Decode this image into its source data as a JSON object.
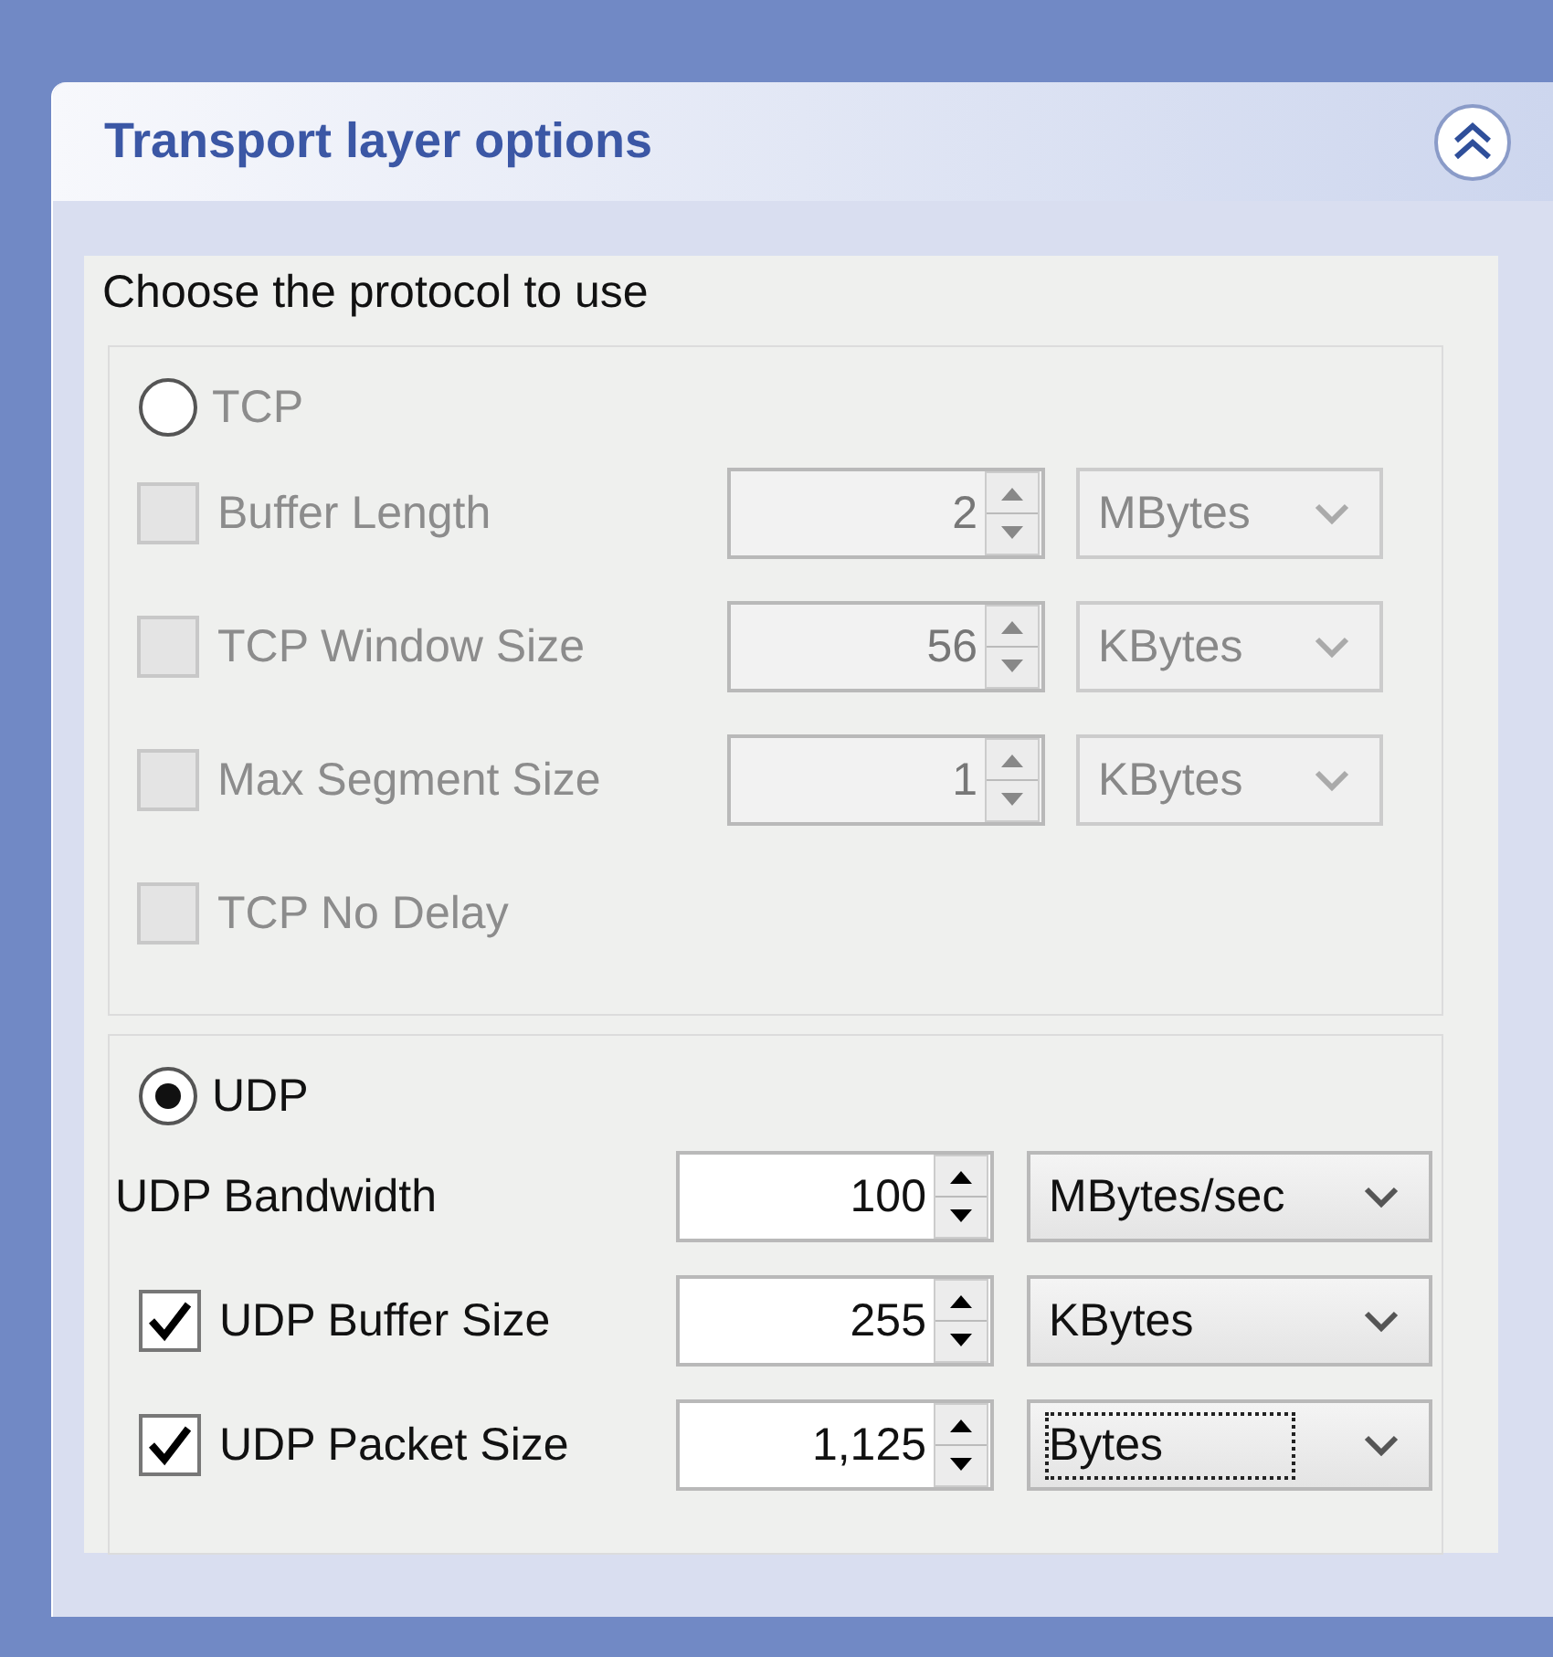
{
  "panel": {
    "title": "Transport layer options",
    "expanded": true
  },
  "prompt": "Choose the protocol to use",
  "protocols": [
    {
      "label": "TCP",
      "selected": false,
      "disabled": true,
      "options": [
        {
          "kind": "checkbox",
          "label": "Buffer Length",
          "checked": false,
          "value": "2",
          "unit": "MBytes",
          "focused": false
        },
        {
          "kind": "checkbox",
          "label": "TCP Window Size",
          "checked": false,
          "value": "56",
          "unit": "KBytes",
          "focused": false
        },
        {
          "kind": "checkbox",
          "label": "Max Segment Size",
          "checked": false,
          "value": "1",
          "unit": "KBytes",
          "focused": false
        },
        {
          "kind": "checkbox",
          "label": "TCP No Delay",
          "checked": false
        }
      ]
    },
    {
      "label": "UDP",
      "selected": true,
      "disabled": false,
      "options": [
        {
          "kind": "plain",
          "label": "UDP Bandwidth",
          "value": "100",
          "unit": "MBytes/sec",
          "focused": false
        },
        {
          "kind": "checkbox",
          "label": "UDP Buffer Size",
          "checked": true,
          "value": "255",
          "unit": "KBytes",
          "focused": false
        },
        {
          "kind": "checkbox",
          "label": "UDP Packet Size",
          "checked": true,
          "value": "1,125",
          "unit": "Bytes",
          "focused": true
        }
      ]
    }
  ]
}
